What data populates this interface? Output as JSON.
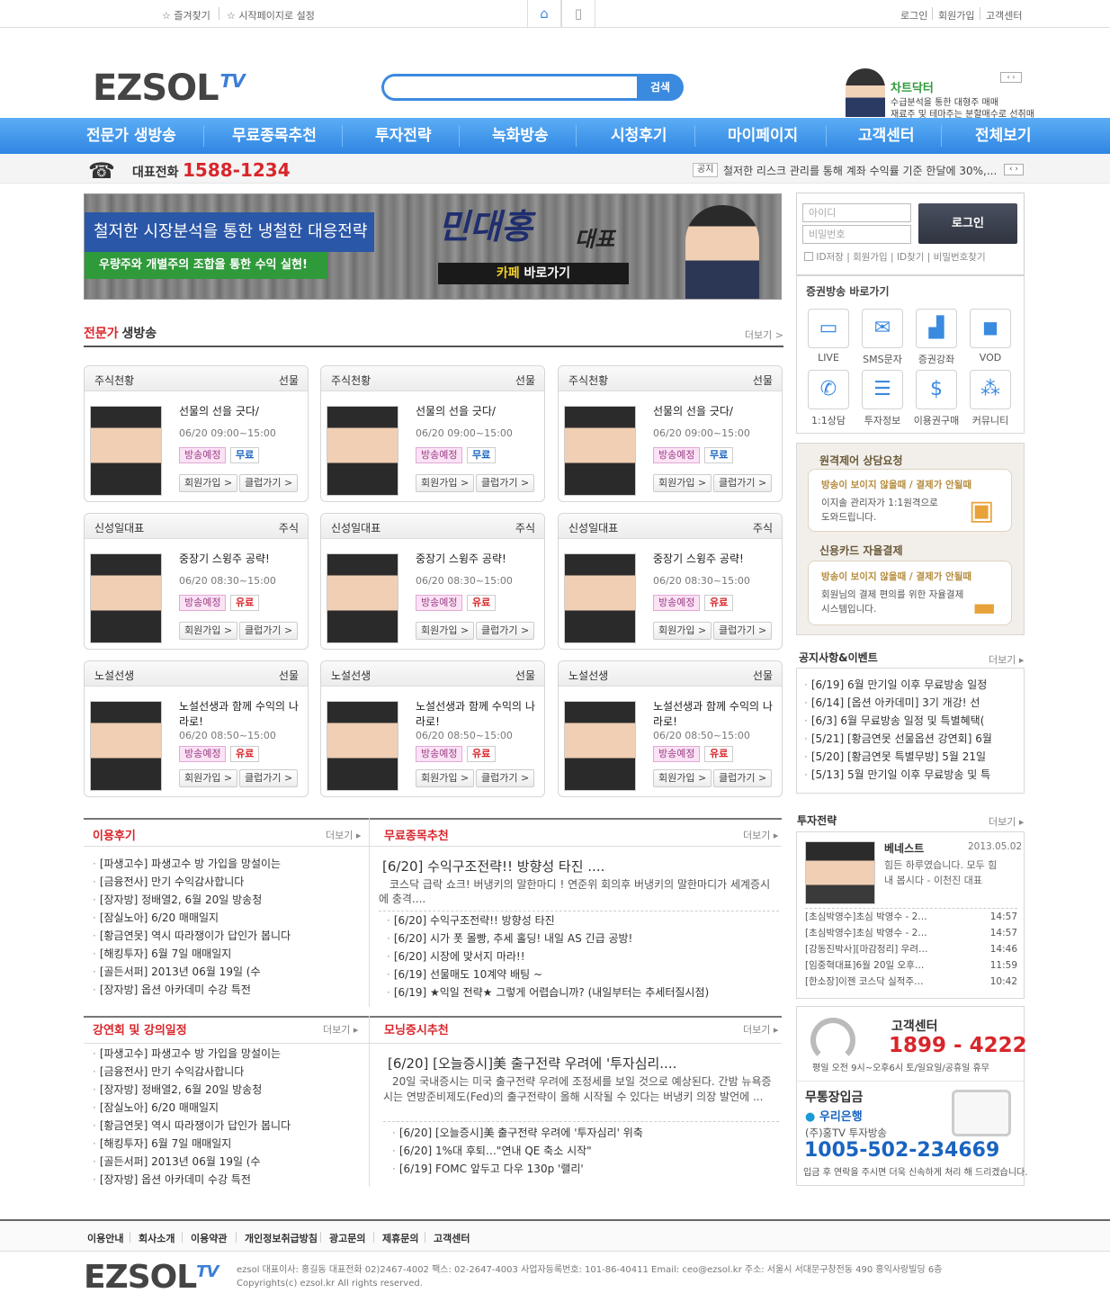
{
  "topbar": {
    "bookmark": "즐겨찾기",
    "startpage": "시작페이지로 설정",
    "login": "로그인",
    "join": "회원가입",
    "support": "고객센터"
  },
  "logo": {
    "text": "EZSOL",
    "tv": "TV"
  },
  "search": {
    "button": "검색",
    "placeholder": ""
  },
  "promo": {
    "title": "차트닥터",
    "line1": "수급분석을 통한 대형주 매매",
    "line2": "재료주 및 테마주는 분할매수로 선취매"
  },
  "nav": [
    "전문가 생방송",
    "무료종목추천",
    "투자전략",
    "녹화방송",
    "시청후기",
    "마이페이지",
    "고객센터",
    "전체보기"
  ],
  "phone": {
    "label": "대표전화",
    "number": "1588-1234"
  },
  "notice": {
    "tag": "공지",
    "text": "철저한 리스크 관리를 통해 계좌 수익률 기준 한달에 30%,..."
  },
  "mainbanner": {
    "line1": "철저한 시장분석을 통한 냉철한 대응전략",
    "line2": "우량주와 개별주의 조합을 통한 수익 실현!",
    "name": "민대홍",
    "title": "대표",
    "cafe_hl": "카페",
    "cafe": "바로가기"
  },
  "live": {
    "title_red": "전문가",
    "title": "생방송",
    "more": "더보기 >"
  },
  "cards": [
    {
      "name": "주식천황",
      "type": "선물",
      "title": "선물의 선을 긋다/",
      "time": "06/20 09:00~15:00",
      "status": "방송예정",
      "price": "무료"
    },
    {
      "name": "주식천황",
      "type": "선물",
      "title": "선물의 선을 긋다/",
      "time": "06/20 09:00~15:00",
      "status": "방송예정",
      "price": "무료"
    },
    {
      "name": "주식천황",
      "type": "선물",
      "title": "선물의 선을 긋다/",
      "time": "06/20 09:00~15:00",
      "status": "방송예정",
      "price": "무료"
    },
    {
      "name": "신성일대표",
      "type": "주식",
      "title": "중장기 스윙주 공략!",
      "time": "06/20 08:30~15:00",
      "status": "방송예정",
      "price": "유료"
    },
    {
      "name": "신성일대표",
      "type": "주식",
      "title": "중장기 스윙주 공략!",
      "time": "06/20 08:30~15:00",
      "status": "방송예정",
      "price": "유료"
    },
    {
      "name": "신성일대표",
      "type": "주식",
      "title": "중장기 스윙주 공략!",
      "time": "06/20 08:30~15:00",
      "status": "방송예정",
      "price": "유료"
    },
    {
      "name": "노설선생",
      "type": "선물",
      "title": "노설선생과 함께 수익의 나라로!",
      "time": "06/20 08:50~15:00",
      "status": "방송예정",
      "price": "유료"
    },
    {
      "name": "노설선생",
      "type": "선물",
      "title": "노설선생과 함께 수익의 나라로!",
      "time": "06/20 08:50~15:00",
      "status": "방송예정",
      "price": "유료"
    },
    {
      "name": "노설선생",
      "type": "선물",
      "title": "노설선생과 함께 수익의 나라로!",
      "time": "06/20 08:50~15:00",
      "status": "방송예정",
      "price": "유료"
    }
  ],
  "card_buttons": {
    "join": "회원가입 >",
    "club": "클럽가기 >"
  },
  "reviews": {
    "title": "이용후기",
    "more": "더보기",
    "items": [
      "[파생고수] 파생고수 방 가입을 망설이는",
      "[금융전사] 만기 수익감사합니다",
      "[장자방] 정배열2, 6월 20일 방송청",
      "[잠실노아] 6/20 매매일지",
      "[황금연못] 역시 따라쟁이가 답인가 봅니다",
      "[해킹투자] 6월 7일 매매일지",
      "[골든서퍼] 2013년 06월 19일 (수",
      "[장자방] 옵션 아카데미 수강 특전"
    ]
  },
  "freepicks": {
    "title": "무료종목추천",
    "more": "더보기",
    "headline": "[6/20] 수익구조전략!! 방향성 타진 ....",
    "summary": "코스닥 급락 쇼크! 버냉키의 말한마디 !  연준위 회의후 버냉키의 말한마디가 세계증시에 충격....",
    "items": [
      "[6/20] 수익구조전략!! 방향성 타진",
      "[6/20] 시가 폿 몰빵, 추세 홀딩! 내일 AS 긴급 공방!",
      "[6/20] 시장에 맞서지 마라!!",
      "[6/19] 선물매도 10계약 배팅 ~",
      "[6/19] ★익일 전략★ 그렇게 어렵습니까? (내일부터는 추세터질시점)"
    ]
  },
  "lectures": {
    "title": "강연회 및 강의일정",
    "more": "더보기",
    "items": [
      "[파생고수] 파생고수 방 가입을 망설이는",
      "[금융전사] 만기 수익감사합니다",
      "[장자방] 정배열2, 6월 20일 방송청",
      "[잠실노아] 6/20 매매일지",
      "[황금연못] 역시 따라쟁이가 답인가 봅니다",
      "[해킹투자] 6월 7일 매매일지",
      "[골든서퍼] 2013년 06월 19일 (수",
      "[장자방] 옵션 아카데미 수강 특전"
    ]
  },
  "morning": {
    "title": "모닝증시추천",
    "more": "더보기",
    "headline": "[6/20] [오늘증시]美 출구전략 우려에 '투자심리....",
    "summary": "20일 국내증시는 미국 출구전략 우려에 조정세를 보일 것으로 예상된다. 간밤 뉴욕증시는 연방준비제도(Fed)의 출구전략이 올해 시작될 수 있다는 버냉키 의장 발언에 ...",
    "items": [
      "[6/20] [오늘증시]美 출구전략 우려에 '투자심리' 위축",
      "[6/20] 1%대 후퇴…\"연내 QE 축소 시작\"",
      "[6/19] FOMC 앞두고 다우 130p '랠리'"
    ]
  },
  "login": {
    "id_ph": "아이디",
    "pw_ph": "비밀번호",
    "button": "로그인",
    "save_id": "ID저장",
    "join": "회원가입",
    "find_id": "ID찾기",
    "find_pw": "비밀번호찾기"
  },
  "broadcast": {
    "title": "증권방송 바로가기",
    "items": [
      {
        "label": "LIVE",
        "icon": "tv-icon",
        "glyph": "▭"
      },
      {
        "label": "SMS문자",
        "icon": "mail-icon",
        "glyph": "✉"
      },
      {
        "label": "증권강좌",
        "icon": "chart-icon",
        "glyph": "▟"
      },
      {
        "label": "VOD",
        "icon": "camera-icon",
        "glyph": "◼"
      },
      {
        "label": "1:1상담",
        "icon": "phone-icon",
        "glyph": "✆"
      },
      {
        "label": "투자정보",
        "icon": "clipboard-icon",
        "glyph": "☰"
      },
      {
        "label": "이용권구매",
        "icon": "money-bag-icon",
        "glyph": "$"
      },
      {
        "label": "커뮤니티",
        "icon": "community-icon",
        "glyph": "⁂"
      }
    ]
  },
  "remote": {
    "title": "원격제어 상담요청",
    "sub": "방송이 보이지 않을때 / 결제가 안될때",
    "line1": "이지솔 관리자가 1:1원격으로",
    "line2": "도와드립니다."
  },
  "card_pay": {
    "title": "신용카드 자율결제",
    "sub": "방송이 보이지 않을때 / 결제가 안될때",
    "line1": "회원님의 결제 편의를 위한 자율결제",
    "line2": "시스템입니다."
  },
  "notices": {
    "title": "공지사항&이벤트",
    "more": "더보기",
    "items": [
      "[6/19] 6월 만기일 이후 무료방송 일정",
      "[6/14] [옵션 아카데미] 3기 개강! 선",
      "[6/3] 6월 무료방송 일정 및 특별혜택(",
      "[5/21] [황금연못 선물옵션 강연회] 6월",
      "[5/20] [황금연못 특별무방] 5월 21일",
      "[5/13] 5월 만기일 이후 무료방송 및 특"
    ]
  },
  "strategy": {
    "title": "투자전략",
    "more": "더보기",
    "name": "베네스트",
    "date": "2013.05.02",
    "text1": "힘든 하루였습니다. 모두 힘",
    "text2": "내 봅시다 - 이천진 대표",
    "items": [
      {
        "t": "[초심박영수]초심 박영수 - 2…",
        "time": "14:57"
      },
      {
        "t": "[초심박영수]초심 박영수 - 2…",
        "time": "14:57"
      },
      {
        "t": "[강동진박사][마감정리] 우려…",
        "time": "14:46"
      },
      {
        "t": "[임중혁대표]6월 20일 오후…",
        "time": "11:59"
      },
      {
        "t": "[한소장]이젠 코스닥 실적주…",
        "time": "10:42"
      }
    ]
  },
  "cs": {
    "title": "고객센터",
    "number": "1899 - 4222",
    "hours": "평일 오전 9시~오후6시 토/일요일/공휴일 휴무"
  },
  "bank": {
    "title": "무통장입금",
    "bank": "우리은행",
    "holder": "(주)홍TV 투자방송",
    "account": "1005-502-234669",
    "note": "입금 후 연락을 주시면 더욱 신속하게 처리 해 드리겠습니다."
  },
  "footer": {
    "links": [
      "이용안내",
      "회사소개",
      "이용약관",
      "개인정보취급방침",
      "광고문의",
      "제휴문의",
      "고객센터"
    ],
    "info": "ezsol 대표이사: 홍길동  대표전화 02)2467-4002 팩스: 02-2647-4003  사업자등록번호: 101-86-40411 Email: ceo@ezsol.kr 주소: 서울시 서대문구창전동 490 홍익사랑빌딩 6층",
    "copy": "Copyrights(c) ezsol.kr All rights reserved."
  },
  "colors": {
    "accent": "#3a8ae0",
    "red": "#d8262b",
    "green": "#2f9a3a",
    "gold": "#b48b3c"
  }
}
